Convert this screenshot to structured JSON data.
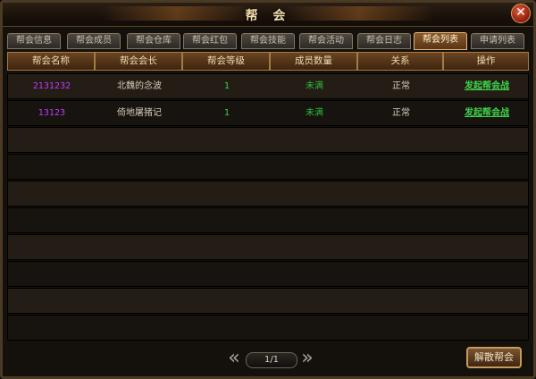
{
  "window": {
    "title": "帮 会",
    "close_icon": "close-icon"
  },
  "tabs": [
    {
      "label": "帮会信息",
      "active": false
    },
    {
      "label": "帮会成员",
      "active": false
    },
    {
      "label": "帮会仓库",
      "active": false
    },
    {
      "label": "帮会红包",
      "active": false
    },
    {
      "label": "帮会技能",
      "active": false
    },
    {
      "label": "帮会活动",
      "active": false
    },
    {
      "label": "帮会日志",
      "active": false
    },
    {
      "label": "帮会列表",
      "active": true
    },
    {
      "label": "申请列表",
      "active": false
    }
  ],
  "table": {
    "headers": [
      "帮会名称",
      "帮会会长",
      "帮会等级",
      "成员数量",
      "关系",
      "操作"
    ],
    "rows": [
      {
        "name": "2131232",
        "leader": "北魏的念波",
        "level": "1",
        "members": "未满",
        "relation": "正常",
        "action": "发起帮会战"
      },
      {
        "name": "13123",
        "leader": "倚地屠猪记",
        "level": "1",
        "members": "未满",
        "relation": "正常",
        "action": "发起帮会战"
      }
    ]
  },
  "pager": {
    "text": "1/1"
  },
  "disband_label": "解散帮会",
  "colors": {
    "guild_name": "#c23bff",
    "level": "#34d24a",
    "action": "#3fd44b",
    "frame": "#4a3a24"
  }
}
